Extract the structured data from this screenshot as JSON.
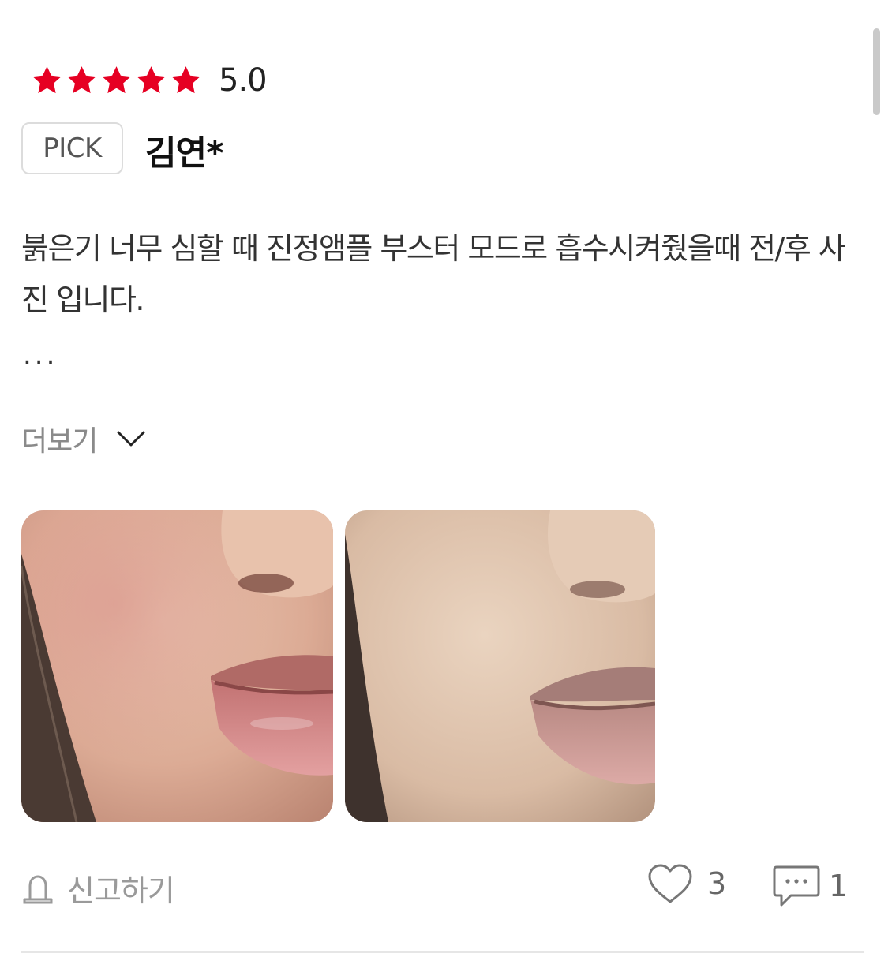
{
  "review": {
    "rating": {
      "value": 5,
      "max": 5,
      "score_label": "5.0",
      "star_color": "#e60023",
      "star_icon": "star-icon"
    },
    "pick_label": "PICK",
    "author": "김연*",
    "text": "붉은기 너무 심할 때 진정앰플 부스터 모드로 흡수시켜줬을때 전/후 사진 입니다.",
    "ellipsis": "...",
    "more_label": "더보기",
    "more_icon": "chevron-down-icon",
    "photos": [
      {
        "name": "before-photo"
      },
      {
        "name": "after-photo"
      }
    ]
  },
  "actions": {
    "report_label": "신고하기",
    "report_icon": "bell-icon",
    "like_icon": "heart-icon",
    "like_count": "3",
    "comment_icon": "comment-icon",
    "comment_count": "1"
  }
}
